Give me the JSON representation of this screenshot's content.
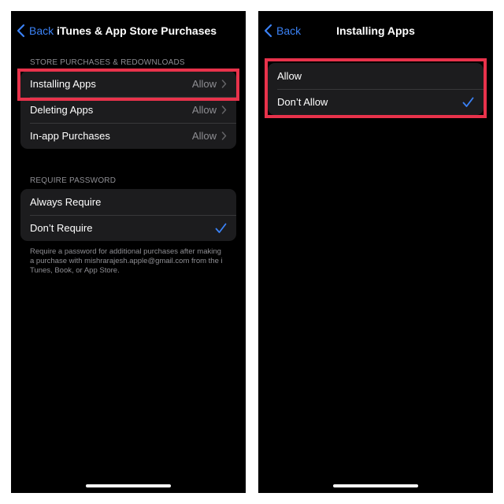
{
  "accent_color": "#3b82f6",
  "highlight_color": "#e8324b",
  "left_screen": {
    "nav": {
      "back_label": "Back",
      "title": "iTunes & App Store Purchases"
    },
    "store_section": {
      "header": "STORE PURCHASES & REDOWNLOADS",
      "rows": [
        {
          "label": "Installing Apps",
          "value": "Allow",
          "icon": "chevron-right-icon",
          "highlighted": true
        },
        {
          "label": "Deleting Apps",
          "value": "Allow",
          "icon": "chevron-right-icon"
        },
        {
          "label": "In-app Purchases",
          "value": "Allow",
          "icon": "chevron-right-icon"
        }
      ]
    },
    "password_section": {
      "header": "REQUIRE PASSWORD",
      "rows": [
        {
          "label": "Always Require",
          "selected": false
        },
        {
          "label": "Don’t Require",
          "selected": true,
          "icon": "checkmark-icon"
        }
      ],
      "footer": "Require a password for additional purchases after making a purchase with mishrarajesh.apple@gmail.com from the iTunes, Book, or App Store."
    }
  },
  "right_screen": {
    "nav": {
      "back_label": "Back",
      "title": "Installing Apps"
    },
    "options": [
      {
        "label": "Allow",
        "selected": false
      },
      {
        "label": "Don’t Allow",
        "selected": true,
        "icon": "checkmark-icon"
      }
    ],
    "highlighted": true
  }
}
